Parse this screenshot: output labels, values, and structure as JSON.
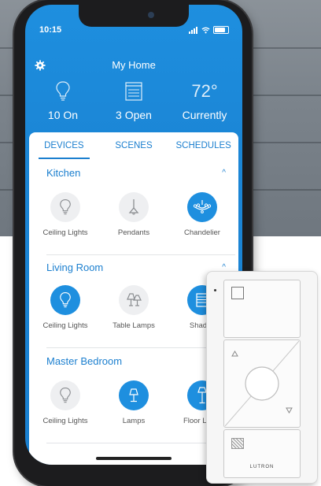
{
  "status_bar": {
    "time": "10:15"
  },
  "header": {
    "title": "My Home"
  },
  "summary": [
    {
      "icon": "bulb-icon",
      "label": "10 On"
    },
    {
      "icon": "blinds-icon",
      "label": "3 Open"
    },
    {
      "icon": "temperature",
      "value": "72°",
      "label": "Currently"
    }
  ],
  "tabs": [
    {
      "label": "DEVICES",
      "active": true
    },
    {
      "label": "SCENES",
      "active": false
    },
    {
      "label": "SCHEDULES",
      "active": false
    }
  ],
  "rooms": [
    {
      "name": "Kitchen",
      "caret": "^",
      "devices": [
        {
          "label": "Ceiling Lights",
          "icon": "bulb-icon",
          "on": false
        },
        {
          "label": "Pendants",
          "icon": "pendant-icon",
          "on": false
        },
        {
          "label": "Chandelier",
          "icon": "chandelier-icon",
          "on": true
        }
      ]
    },
    {
      "name": "Living Room",
      "caret": "^",
      "devices": [
        {
          "label": "Ceiling Lights",
          "icon": "bulb-icon",
          "on": true
        },
        {
          "label": "Table Lamps",
          "icon": "table-lamps-icon",
          "on": false
        },
        {
          "label": "Shades",
          "icon": "shades-icon",
          "on": true
        }
      ]
    },
    {
      "name": "Master Bedroom",
      "devices": [
        {
          "label": "Ceiling Lights",
          "icon": "bulb-icon",
          "on": false
        },
        {
          "label": "Lamps",
          "icon": "lamp-icon",
          "on": true
        },
        {
          "label": "Floor Lamp",
          "icon": "floor-lamp-icon",
          "on": true
        }
      ]
    }
  ],
  "remote": {
    "brand": "LUTRON"
  },
  "colors": {
    "accent": "#1e8fdf",
    "tab_text": "#1b7fcf",
    "off_circle": "#eeeff1",
    "wall": "#7c848c"
  }
}
